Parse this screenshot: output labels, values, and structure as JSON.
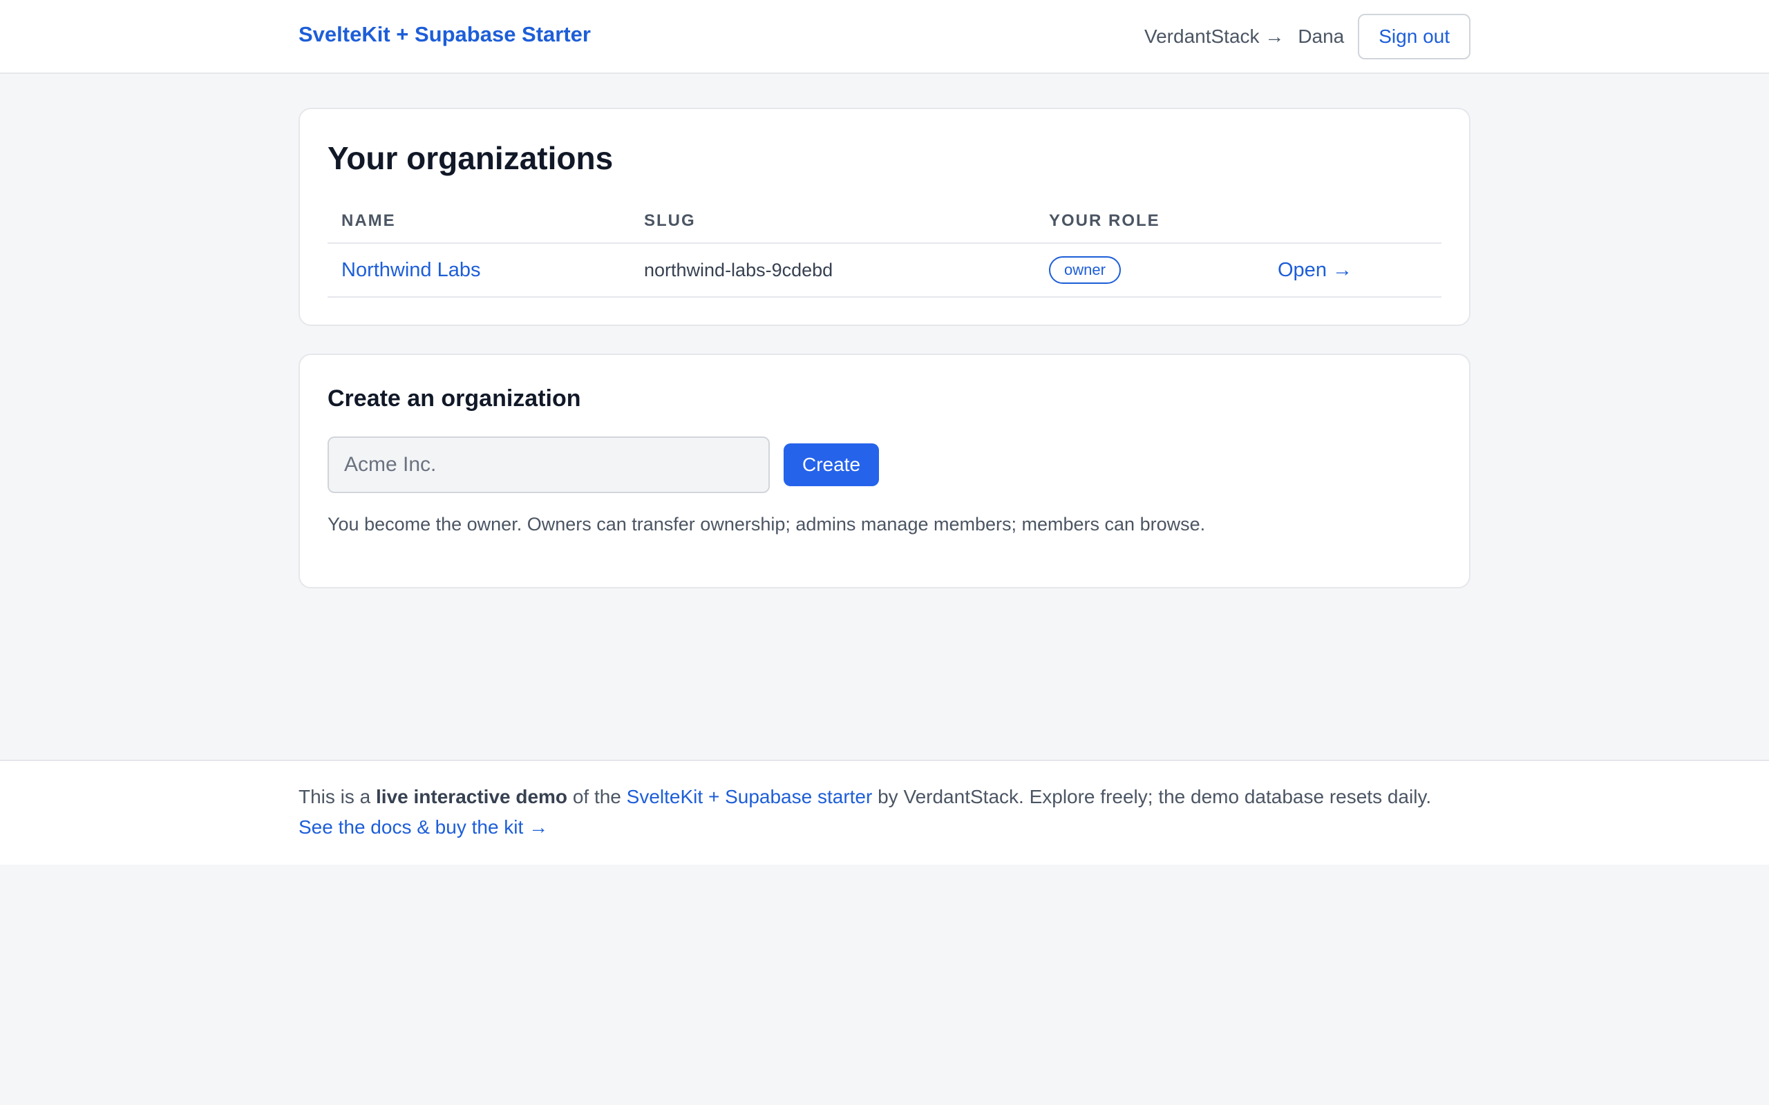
{
  "header": {
    "brand": "SvelteKit + Supabase Starter",
    "vendor_link": "VerdantStack →",
    "user_name": "Dana",
    "signout_label": "Sign out"
  },
  "organizations": {
    "title": "Your organizations",
    "columns": [
      "NAME",
      "SLUG",
      "YOUR ROLE"
    ],
    "rows": [
      {
        "name": "Northwind Labs",
        "slug": "northwind-labs-9cdebd",
        "role": "owner",
        "open_label": "Open →"
      }
    ]
  },
  "create": {
    "title": "Create an organization",
    "input_value": "",
    "input_placeholder": "Acme Inc.",
    "button_label": "Create",
    "help_text": "You become the owner. Owners can transfer ownership; admins manage members; members can browse."
  },
  "footer": {
    "prefix": "This is a ",
    "emphasis": "live interactive demo",
    "middle": " of the ",
    "starter_link": "SvelteKit + Supabase starter",
    "suffix": " by VerdantStack. Explore freely; the demo database resets daily.",
    "docs_link": "See the docs & buy the kit →"
  },
  "colors": {
    "accent": "#1d5ed8",
    "primary_button": "#2563eb",
    "page_background": "#f5f6f8"
  }
}
